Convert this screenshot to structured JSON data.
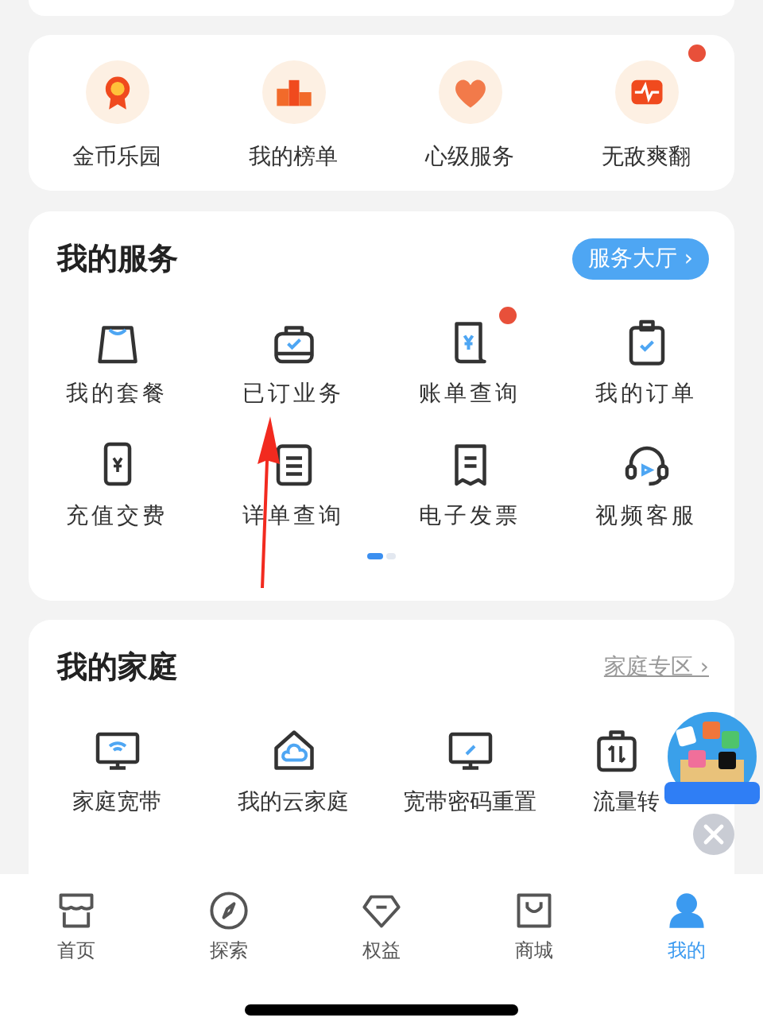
{
  "quick_links": [
    {
      "label": "金币乐园",
      "badge": false
    },
    {
      "label": "我的榜单",
      "badge": false
    },
    {
      "label": "心级服务",
      "badge": false
    },
    {
      "label": "无敌爽翻",
      "badge": true
    }
  ],
  "services": {
    "title": "我的服务",
    "hall_button": "服务大厅 ›",
    "items": [
      {
        "label": "我的套餐",
        "badge": false
      },
      {
        "label": "已订业务",
        "badge": false
      },
      {
        "label": "账单查询",
        "badge": true
      },
      {
        "label": "我的订单",
        "badge": false
      },
      {
        "label": "充值交费",
        "badge": false
      },
      {
        "label": "详单查询",
        "badge": false
      },
      {
        "label": "电子发票",
        "badge": false
      },
      {
        "label": "视频客服",
        "badge": false
      }
    ],
    "pager": [
      {
        "selected": true
      },
      {
        "selected": false
      }
    ]
  },
  "family": {
    "title": "我的家庭",
    "link": "家庭专区 ›",
    "items": [
      {
        "label": "家庭宽带"
      },
      {
        "label": "我的云家庭"
      },
      {
        "label": "宽带密码重置"
      },
      {
        "label": "流量转"
      }
    ]
  },
  "tab_bar": [
    {
      "label": "首页",
      "selected": false
    },
    {
      "label": "探索",
      "selected": false
    },
    {
      "label": "权益",
      "selected": false
    },
    {
      "label": "商城",
      "selected": false
    },
    {
      "label": "我的",
      "selected": true
    }
  ]
}
